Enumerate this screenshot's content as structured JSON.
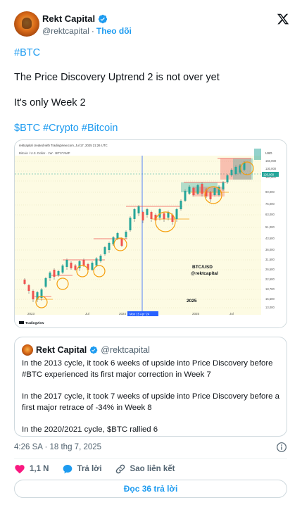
{
  "author": {
    "name": "Rekt Capital",
    "handle": "@rektcapital",
    "separator": "·",
    "follow_label": "Theo dõi"
  },
  "tweet": {
    "line1": "#BTC",
    "line2": "The Price Discovery Uptrend 2 is not over yet",
    "line3": "It's only Week 2",
    "line4": "$BTC #Crypto #Bitcoin"
  },
  "chart_image": {
    "credit": "rektcapital created with TradingView.com, Jul 17, 2025 21:26 UTC",
    "symbol": "Bitcoin / U.S. Dollar · 1W · BITSTAMP",
    "axis_currency": "USD",
    "y_ticks": [
      "150,000",
      "130,000",
      "110,000",
      "90,000",
      "75,000",
      "63,000",
      "51,000",
      "43,500",
      "36,000",
      "31,500",
      "26,500",
      "22,500",
      "18,700",
      "15,500",
      "13,000"
    ],
    "price_tag": "120,000",
    "x_ticks": [
      "2023",
      "Jul",
      "2024",
      "2025",
      "Jul"
    ],
    "crosshair_date": "Mon 15 Apr '24",
    "label_pair": "BTC/USD",
    "label_author": "@rektcapital",
    "label_year": "2025",
    "logo": "TradingView",
    "colors": {
      "up": "#26a69a",
      "down": "#ef5350",
      "highlight": "#f59e0b",
      "background": "#fdfbe3"
    }
  },
  "quote": {
    "name": "Rekt Capital",
    "handle": "@rektcapital",
    "para1": "In the 2013 cycle, it took 6 weeks of upside into Price Discovery before #BTC experienced its first major correction in Week 7",
    "para2": "In the 2017 cycle, it took 7 weeks of upside into Price Discovery before a first major retrace of -34% in Week 8",
    "para3": "In the 2020/2021 cycle, $BTC rallied 6"
  },
  "meta": {
    "time": "4:26 SA · 18 thg 7, 2025"
  },
  "actions": {
    "likes": "1,1 N",
    "reply_label": "Trả lời",
    "copy_link_label": "Sao liên kết"
  },
  "read_replies_label": "Đọc 36 trả lời"
}
